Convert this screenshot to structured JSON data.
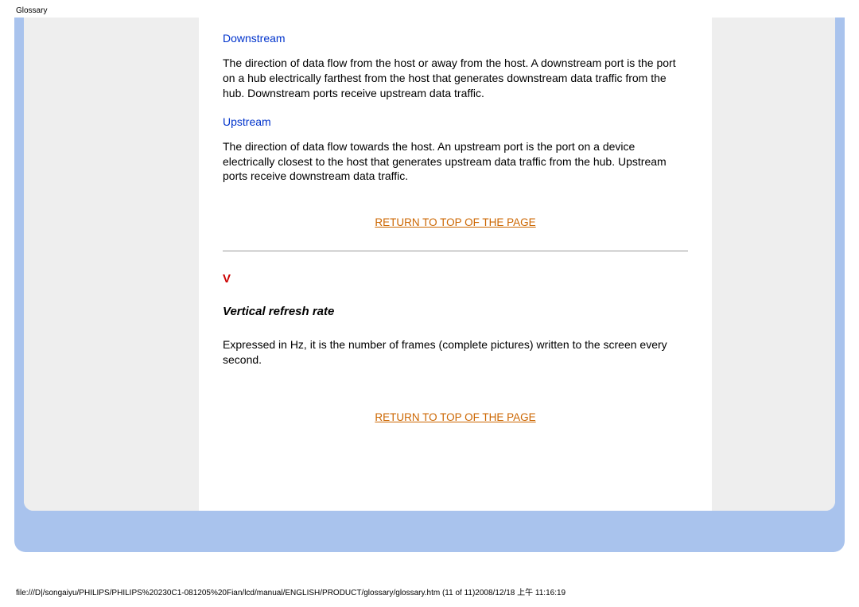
{
  "header": {
    "label": "Glossary"
  },
  "entries": {
    "downstream": {
      "title": "Downstream",
      "body": "The direction of data flow from the host or away from the host. A downstream port is the port on a hub electrically farthest from the host that generates downstream data traffic from the hub. Downstream ports receive upstream data traffic."
    },
    "upstream": {
      "title": "Upstream",
      "body": "The direction of data flow towards the host. An upstream port is the port on a device electrically closest to the host that generates upstream data traffic from the hub. Upstream ports receive downstream data traffic."
    },
    "vertical_refresh": {
      "title": "Vertical refresh rate",
      "body": "Expressed in Hz, it is the number of frames (complete pictures) written to the screen every second."
    }
  },
  "section_letter": "V",
  "return_link": "RETURN TO TOP OF THE PAGE",
  "footer": {
    "path": "file:///D|/songaiyu/PHILIPS/PHILIPS%20230C1-081205%20Fian/lcd/manual/ENGLISH/PRODUCT/glossary/glossary.htm (11 of 11)2008/12/18 上午 11:16:19"
  }
}
